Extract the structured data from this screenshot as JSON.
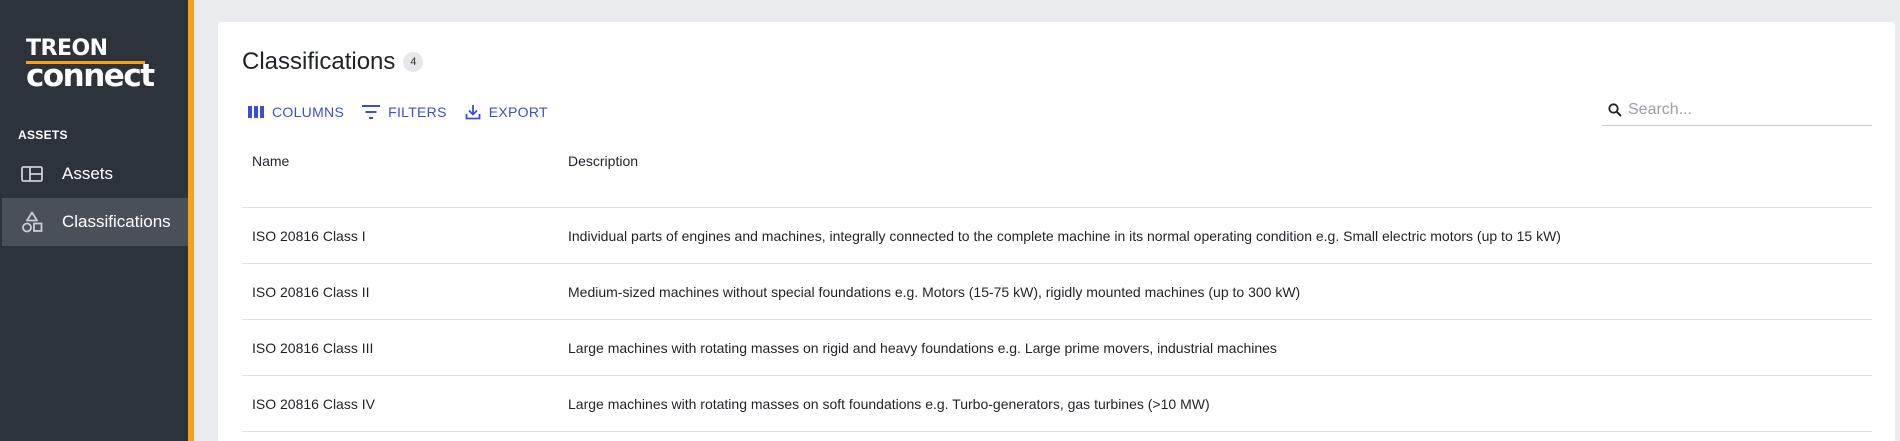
{
  "brand": {
    "logo_top": "TREON",
    "logo_bottom": "connect",
    "accent_color": "#f5a31a"
  },
  "sidebar": {
    "section_label": "ASSETS",
    "items": [
      {
        "label": "Assets",
        "icon": "dashboard-grid-icon",
        "active": false
      },
      {
        "label": "Classifications",
        "icon": "shapes-icon",
        "active": true
      }
    ]
  },
  "main": {
    "title": "Classifications",
    "count": "4",
    "toolbar": {
      "columns_label": "COLUMNS",
      "filters_label": "FILTERS",
      "export_label": "EXPORT"
    },
    "search": {
      "placeholder": "Search...",
      "value": ""
    },
    "table": {
      "columns": [
        "Name",
        "Description"
      ],
      "rows": [
        {
          "name": "ISO 20816 Class I",
          "description": "Individual parts of engines and machines, integrally connected to the complete machine in its normal operating condition e.g. Small electric motors (up to 15 kW)"
        },
        {
          "name": "ISO 20816 Class II",
          "description": "Medium-sized machines without special foundations e.g. Motors (15-75 kW), rigidly mounted machines (up to 300 kW)"
        },
        {
          "name": "ISO 20816 Class III",
          "description": "Large machines with rotating masses on rigid and heavy foundations e.g. Large prime movers, industrial machines"
        },
        {
          "name": "ISO 20816 Class IV",
          "description": "Large machines with rotating masses on soft foundations e.g. Turbo-generators, gas turbines (>10 MW)"
        }
      ]
    }
  }
}
